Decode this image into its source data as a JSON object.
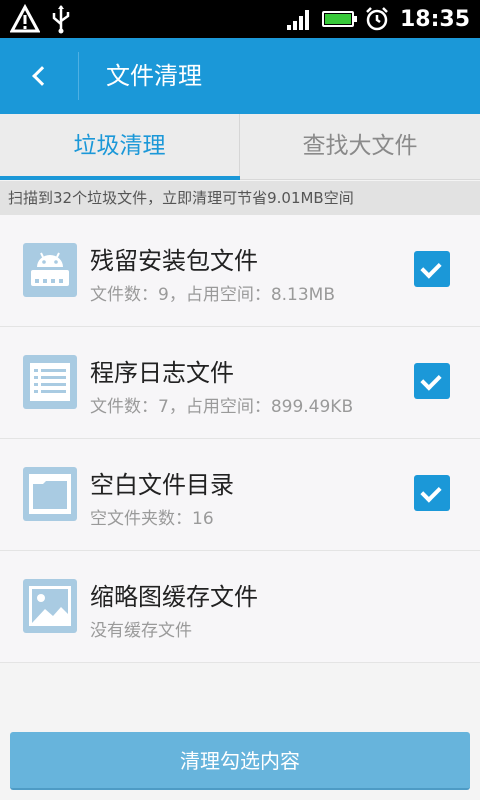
{
  "status_bar": {
    "time": "18:35",
    "battery_level": 1.0,
    "icons": [
      "warning-icon",
      "usb-icon",
      "signal-icon",
      "battery-icon",
      "alarm-icon"
    ]
  },
  "header": {
    "title": "文件清理",
    "back_icon": "chevron-left-icon"
  },
  "tabs": [
    {
      "label": "垃圾清理",
      "active": true
    },
    {
      "label": "查找大文件",
      "active": false
    }
  ],
  "summary": "扫描到32个垃圾文件，立即清理可节省9.01MB空间",
  "items": [
    {
      "name": "残留安装包文件",
      "detail": "文件数：9，占用空间：8.13MB",
      "icon": "android-icon",
      "checked": true
    },
    {
      "name": "程序日志文件",
      "detail": "文件数：7，占用空间：899.49KB",
      "icon": "list-icon",
      "checked": true
    },
    {
      "name": "空白文件目录",
      "detail": "空文件夹数：16",
      "icon": "folder-icon",
      "checked": true
    },
    {
      "name": "缩略图缓存文件",
      "detail": "没有缓存文件",
      "icon": "image-icon",
      "checked": false
    }
  ],
  "action_button": "清理勾选内容",
  "colors": {
    "accent": "#1b98d8",
    "button": "#67b4dc",
    "icon": "#a9cbe2"
  }
}
